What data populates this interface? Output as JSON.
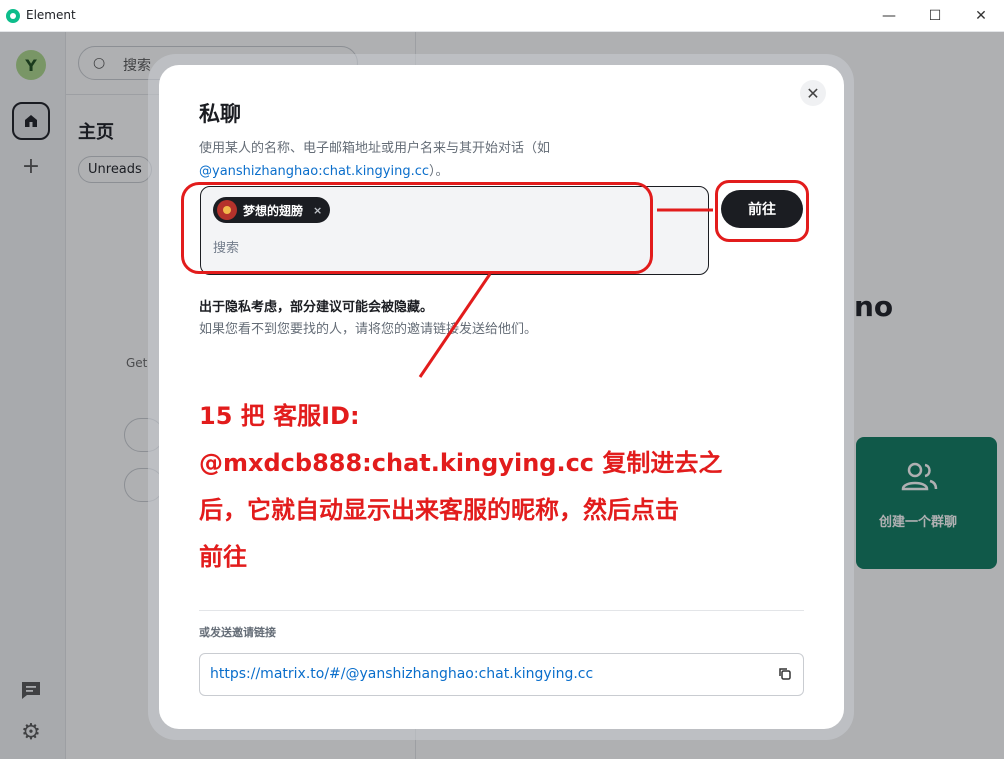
{
  "window": {
    "title": "Element",
    "minimize": "—",
    "maximize": "☐",
    "close": "✕"
  },
  "rail": {
    "avatar_letter": "Y",
    "plus": "+",
    "gear": "⚙"
  },
  "roomlist": {
    "search_placeholder": "搜索",
    "heading": "主页",
    "filter_unreads": "Unreads",
    "get_text": "Get"
  },
  "main": {
    "welcome_partial": "no",
    "create_group_label": "创建一个群聊"
  },
  "dialog": {
    "title": "私聊",
    "desc_line1": "使用某人的名称、电子邮箱地址或用户名来与其开始对话（如",
    "desc_link": "@yanshizhanghao:chat.kingying.cc",
    "desc_end": "）。",
    "pill_name": "梦想的翅膀",
    "pill_remove": "×",
    "search_placeholder": "搜索",
    "go_button": "前往",
    "privacy_bold": "出于隐私考虑，部分建议可能会被隐藏。",
    "privacy_text": "如果您看不到您要找的人，请将您的邀请链接发送给他们。",
    "invite_label": "或发送邀请链接",
    "invite_link": "https://matrix.to/#/@yanshizhanghao:chat.kingying.cc",
    "close": "✕"
  },
  "annotation": {
    "line1": "15 把 客服ID:",
    "line2": "@mxdcb888:chat.kingying.cc 复制进去之",
    "line3": "后，它就自动显示出来客服的昵称，然后点击",
    "line4": "前往"
  },
  "colors": {
    "annotation_red": "#e21c1c",
    "accent_green": "#0c7a5e",
    "link_blue": "#0a6ecb"
  }
}
